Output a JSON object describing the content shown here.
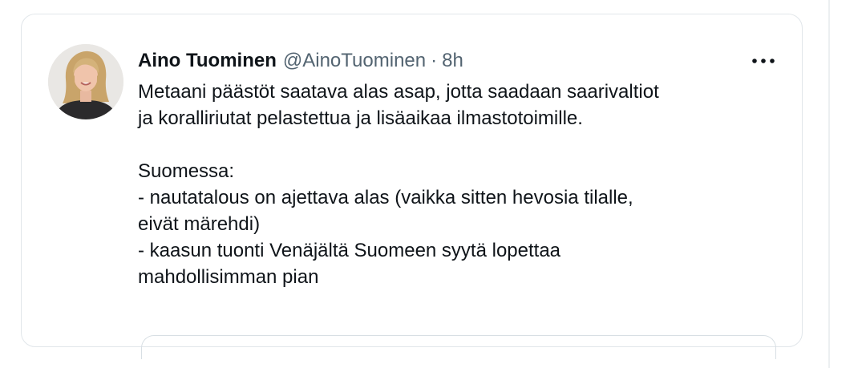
{
  "tweet": {
    "author_name": "Aino Tuominen",
    "author_handle": "@AinoTuominen",
    "separator": "·",
    "time_ago": "8h",
    "more_icon": "ellipsis-horizontal-icon",
    "text_lines": [
      "Metaani päästöt saatava alas asap, jotta saadaan saarivaltiot",
      "ja koralliriutat pelastettua ja lisäaikaa ilmastotoimille.",
      "",
      "Suomessa:",
      "- nautatalous on ajettava alas (vaikka sitten hevosia tilalle,",
      "eivät märehdi)",
      "- kaasun tuonti Venäjältä Suomeen syytä lopettaa",
      "mahdollisimman pian"
    ]
  },
  "colors": {
    "text_primary": "#0f1419",
    "text_secondary": "#536471",
    "border": "#e1e6ea"
  }
}
